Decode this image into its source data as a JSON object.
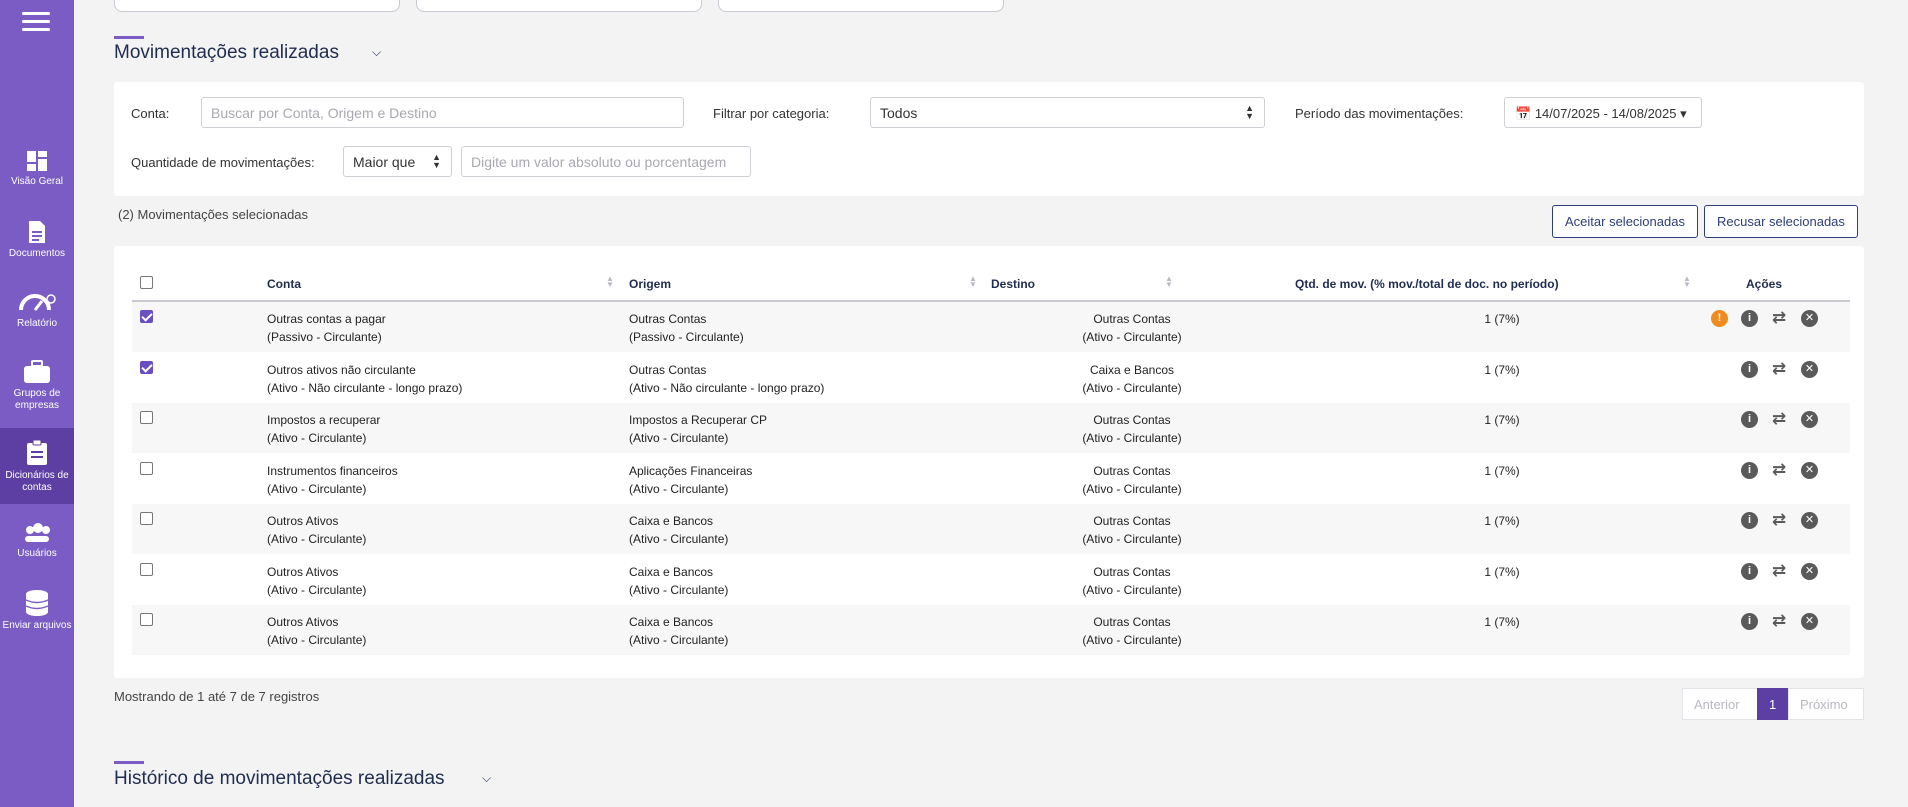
{
  "sidebar": {
    "items": [
      {
        "label": "Visão Geral",
        "icon": "dashboard-icon"
      },
      {
        "label": "Documentos",
        "icon": "document-icon"
      },
      {
        "label": "Relatório",
        "icon": "gauge-icon"
      },
      {
        "label": "Grupos de empresas",
        "icon": "briefcase-icon"
      },
      {
        "label": "Dicionários de contas",
        "icon": "clipboard-icon"
      },
      {
        "label": "Usuários",
        "icon": "users-icon"
      },
      {
        "label": "Enviar arquivos",
        "icon": "database-icon"
      }
    ],
    "color": "#7a5cc4",
    "active_color": "#5d3fa3"
  },
  "section1": {
    "title": "Movimentações realizadas"
  },
  "filters": {
    "conta_label": "Conta:",
    "conta_placeholder": "Buscar por Conta, Origem e Destino",
    "categoria_label": "Filtrar por categoria:",
    "categoria_value": "Todos",
    "periodo_label": "Período das movimentações:",
    "periodo_value": "14/07/2025 - 14/08/2025",
    "quantidade_label": "Quantidade de movimentações:",
    "quantidade_operator": "Maior que",
    "quantidade_placeholder": "Digite um valor absoluto ou porcentagem"
  },
  "selection": {
    "count_text": "(2) Movimentações selecionadas",
    "accept_label": "Aceitar selecionadas",
    "reject_label": "Recusar selecionadas"
  },
  "table": {
    "headers": {
      "conta": "Conta",
      "origem": "Origem",
      "destino": "Destino",
      "qtd": "Qtd. de mov. (% mov./total de doc. no período)",
      "acoes": "Ações"
    },
    "rows": [
      {
        "checked": true,
        "warning": true,
        "conta1": "Outras contas a pagar",
        "conta2": "(Passivo - Circulante)",
        "origem1": "Outras Contas",
        "origem2": "(Passivo - Circulante)",
        "destino1": "Outras Contas",
        "destino2": "(Ativo - Circulante)",
        "qtd": "1 (7%)"
      },
      {
        "checked": true,
        "warning": false,
        "conta1": "Outros ativos não circulante",
        "conta2": "(Ativo - Não circulante - longo prazo)",
        "origem1": "Outras Contas",
        "origem2": "(Ativo - Não circulante - longo prazo)",
        "destino1": "Caixa e Bancos",
        "destino2": "(Ativo - Circulante)",
        "qtd": "1 (7%)"
      },
      {
        "checked": false,
        "warning": false,
        "conta1": "Impostos a recuperar",
        "conta2": "(Ativo - Circulante)",
        "origem1": "Impostos a Recuperar CP",
        "origem2": "(Ativo - Circulante)",
        "destino1": "Outras Contas",
        "destino2": "(Ativo - Circulante)",
        "qtd": "1 (7%)"
      },
      {
        "checked": false,
        "warning": false,
        "conta1": "Instrumentos financeiros",
        "conta2": "(Ativo - Circulante)",
        "origem1": "Aplicações Financeiras",
        "origem2": "(Ativo - Circulante)",
        "destino1": "Outras Contas",
        "destino2": "(Ativo - Circulante)",
        "qtd": "1 (7%)"
      },
      {
        "checked": false,
        "warning": false,
        "conta1": "Outros Ativos",
        "conta2": "(Ativo - Circulante)",
        "origem1": "Caixa e Bancos",
        "origem2": "(Ativo - Circulante)",
        "destino1": "Outras Contas",
        "destino2": "(Ativo - Circulante)",
        "qtd": "1 (7%)"
      },
      {
        "checked": false,
        "warning": false,
        "conta1": "Outros Ativos",
        "conta2": "(Ativo - Circulante)",
        "origem1": "Caixa e Bancos",
        "origem2": "(Ativo - Circulante)",
        "destino1": "Outras Contas",
        "destino2": "(Ativo - Circulante)",
        "qtd": "1 (7%)"
      },
      {
        "checked": false,
        "warning": false,
        "conta1": "Outros Ativos",
        "conta2": "(Ativo - Circulante)",
        "origem1": "Caixa e Bancos",
        "origem2": "(Ativo - Circulante)",
        "destino1": "Outras Contas",
        "destino2": "(Ativo - Circulante)",
        "qtd": "1 (7%)"
      }
    ]
  },
  "footer": {
    "showing": "Mostrando de 1 até 7 de 7 registros",
    "prev": "Anterior",
    "page": "1",
    "next": "Próximo"
  },
  "section2": {
    "title": "Histórico de movimentações realizadas"
  }
}
